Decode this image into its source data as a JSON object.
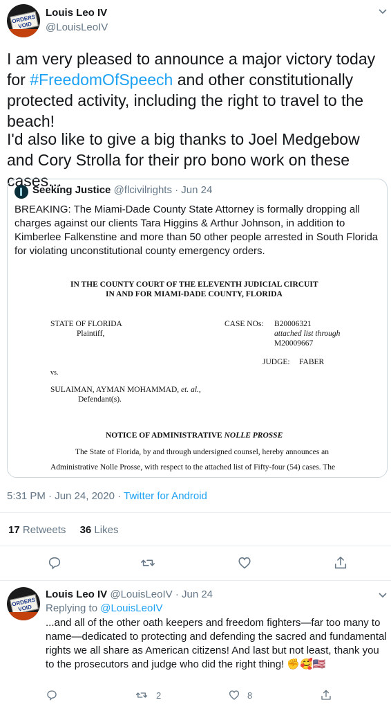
{
  "tweet": {
    "author_name": "Louis Leo IV",
    "author_handle": "@LouisLeoIV",
    "text_part1": "I am very pleased to announce a major victory today for ",
    "hashtag": "#FreedomOfSpeech",
    "text_part2": " and other constitutionally protected activity, including the right to travel to the beach!",
    "text_para2": "I'd also like to give a big thanks to Joel Medgebow and Cory Strolla for their pro bono work on these cases...",
    "timestamp": "5:31 PM · Jun 24, 2020 · ",
    "client": "Twitter for Android",
    "retweets_count": "17",
    "retweets_label": "Retweets",
    "likes_count": "36",
    "likes_label": "Likes"
  },
  "quoted": {
    "author_name": "Seeking Justice",
    "author_handle": "@flcivilrights",
    "date": " · Jun 24",
    "text": "BREAKING: The Miami-Dade County State Attorney is formally dropping all charges against our clients Tara Higgins & Arthur Johnson, in addition to Kimberlee Falkenstine and more than 50 other people arrested in South Florida for violating unconstitutional county emergency orders.",
    "document": {
      "heading1": "IN THE COUNTY COURT OF THE ELEVENTH JUDICIAL CIRCUIT",
      "heading2": "IN AND FOR MIAMI-DADE COUNTY, FLORIDA",
      "state": "STATE OF FLORIDA",
      "plaintiff": "Plaintiff,",
      "case_label": "CASE NOs:",
      "case_no": "B20006321",
      "case_through": "attached list through",
      "case_no2": "M20009667",
      "judge_label": "JUDGE:",
      "judge": "FABER",
      "vs": "vs.",
      "defendant": "SULAIMAN, AYMAN MOHAMMAD,",
      "etal": "et. al.,",
      "defendants_label": "Defendant(s).",
      "notice_title": "NOTICE OF ADMINISTRATIVE ",
      "notice_title_italic": "NOLLE PROSSE",
      "body_line1": "The State of Florida, by and through undersigned counsel, hereby announces an",
      "body_line2": "Administrative Nolle Prosse, with respect to the attached list of Fifty-four (54) cases.  The"
    }
  },
  "reply": {
    "author_name": "Louis Leo IV",
    "author_handle": "@LouisLeoIV",
    "date": " · Jun 24",
    "replying_prefix": "Replying to ",
    "replying_handle": "@LouisLeoIV",
    "text": "...and all of the other oath keepers and freedom fighters—far too many to name—dedicated to protecting and defending the sacred and fundamental rights we all share as American citizens! And last but not least, thank you to the prosecutors and judge who did the right thing! ✊🥰🇺🇸",
    "retweet_count": "2",
    "like_count": "8"
  },
  "avatar": {
    "sign_text": "ORDERS VOID"
  },
  "icons": {
    "chevron": "chevron-down-icon",
    "reply": "reply-icon",
    "retweet": "retweet-icon",
    "like": "heart-icon",
    "share": "share-icon"
  },
  "colors": {
    "accent": "#1da1f2",
    "muted": "#657786",
    "border": "#e6ecf0"
  }
}
